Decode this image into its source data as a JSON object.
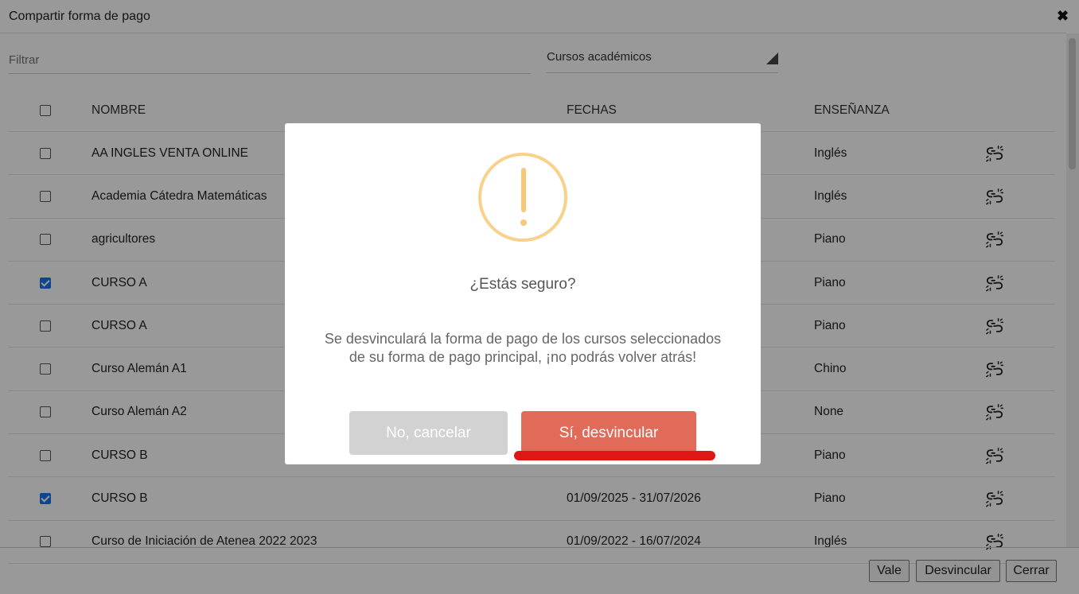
{
  "dialog": {
    "title": "Compartir forma de pago",
    "close_glyph": "✖",
    "filter_placeholder": "Filtrar",
    "filter_value": "",
    "course_select": "Cursos académicos"
  },
  "table": {
    "headers": {
      "name": "NOMBRE",
      "dates": "FECHAS",
      "teaching": "ENSEÑANZA"
    },
    "rows": [
      {
        "name": "AA INGLES VENTA ONLINE",
        "dates": "",
        "teaching": "Inglés",
        "checked": false
      },
      {
        "name": "Academia Cátedra Matemáticas",
        "dates": "",
        "teaching": "Inglés",
        "checked": false
      },
      {
        "name": "agricultores",
        "dates": "",
        "teaching": "Piano",
        "checked": false
      },
      {
        "name": "CURSO A",
        "dates": "",
        "teaching": "Piano",
        "checked": true
      },
      {
        "name": "CURSO A",
        "dates": "",
        "teaching": "Piano",
        "checked": false
      },
      {
        "name": "Curso Alemán A1",
        "dates": "",
        "teaching": "Chino",
        "checked": false
      },
      {
        "name": "Curso Alemán A2",
        "dates": "",
        "teaching": "None",
        "checked": false
      },
      {
        "name": "CURSO B",
        "dates": "",
        "teaching": "Piano",
        "checked": false
      },
      {
        "name": "CURSO B",
        "dates": "01/09/2025 - 31/07/2026",
        "teaching": "Piano",
        "checked": true
      },
      {
        "name": "Curso de Iniciación de Atenea 2022 2023",
        "dates": "01/09/2022 - 16/07/2024",
        "teaching": "Inglés",
        "checked": false
      }
    ],
    "row_icon": "unlink-icon"
  },
  "footer": {
    "ok_label": "Vale",
    "unlink_label": "Desvincular",
    "close_label": "Cerrar"
  },
  "modal": {
    "icon": "warning-icon",
    "title": "¿Estás seguro?",
    "text": "Se desvinculará la forma de pago de los cursos seleccionados de su forma de pago principal, ¡no podrás volver atrás!",
    "cancel_label": "No, cancelar",
    "confirm_label": "Sí, desvincular"
  },
  "colors": {
    "warning": "#f8d18c",
    "confirm": "#e06b58",
    "cancel": "#d2d2d2",
    "highlight": "#e01717",
    "checkbox_checked": "#1a73e8"
  }
}
